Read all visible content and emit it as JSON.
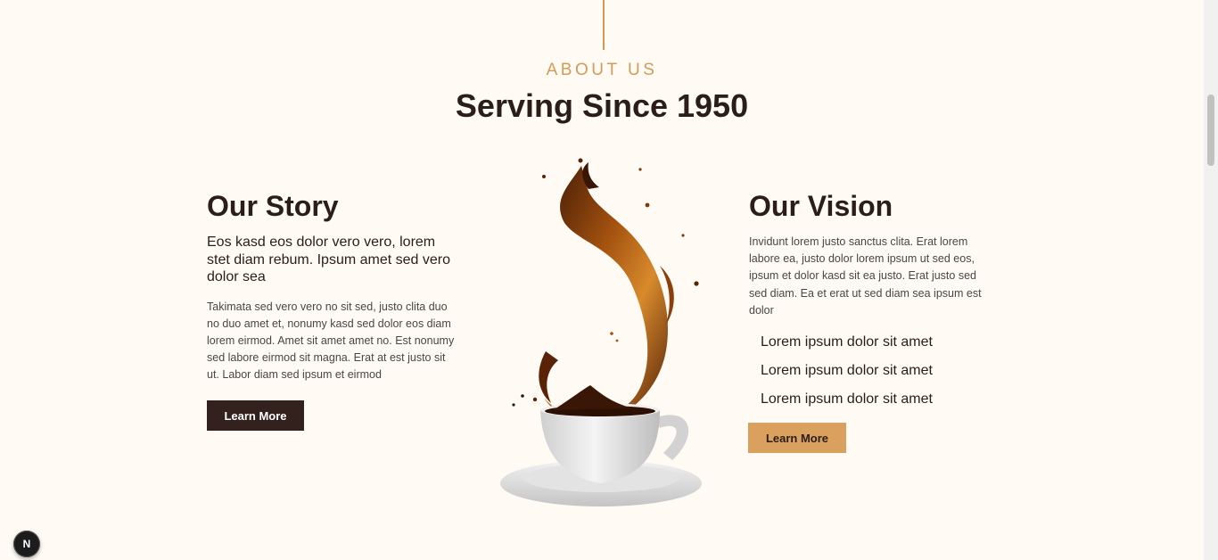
{
  "about": {
    "kicker": "ABOUT US",
    "title": "Serving Since 1950"
  },
  "story": {
    "title": "Our Story",
    "lead": "Eos kasd eos dolor vero vero, lorem stet diam rebum. Ipsum amet sed vero dolor sea",
    "body": "Takimata sed vero vero no sit sed, justo clita duo no duo amet et, nonumy kasd sed dolor eos diam lorem eirmod. Amet sit amet amet no. Est nonumy sed labore eirmod sit magna. Erat at est justo sit ut. Labor diam sed ipsum et eirmod",
    "button_label": "Learn More"
  },
  "vision": {
    "title": "Our Vision",
    "body": "Invidunt lorem justo sanctus clita. Erat lorem labore ea, justo dolor lorem ipsum ut sed eos, ipsum et dolor kasd sit ea justo. Erat justo sed sed diam. Ea et erat ut sed diam sea ipsum est dolor",
    "items": [
      {
        "label": "Lorem ipsum dolor sit amet"
      },
      {
        "label": "Lorem ipsum dolor sit amet"
      },
      {
        "label": "Lorem ipsum dolor sit amet"
      }
    ],
    "button_label": "Learn More"
  },
  "dev_badge": {
    "letter": "N"
  },
  "colors": {
    "background": "#fffaf3",
    "accent_gold": "#d49b57",
    "dark_brown": "#33211d",
    "button_gold": "#d9a15d"
  },
  "icons": {
    "hero_image": "coffee-splash-cup-image",
    "badge": "nextjs-badge-icon"
  }
}
